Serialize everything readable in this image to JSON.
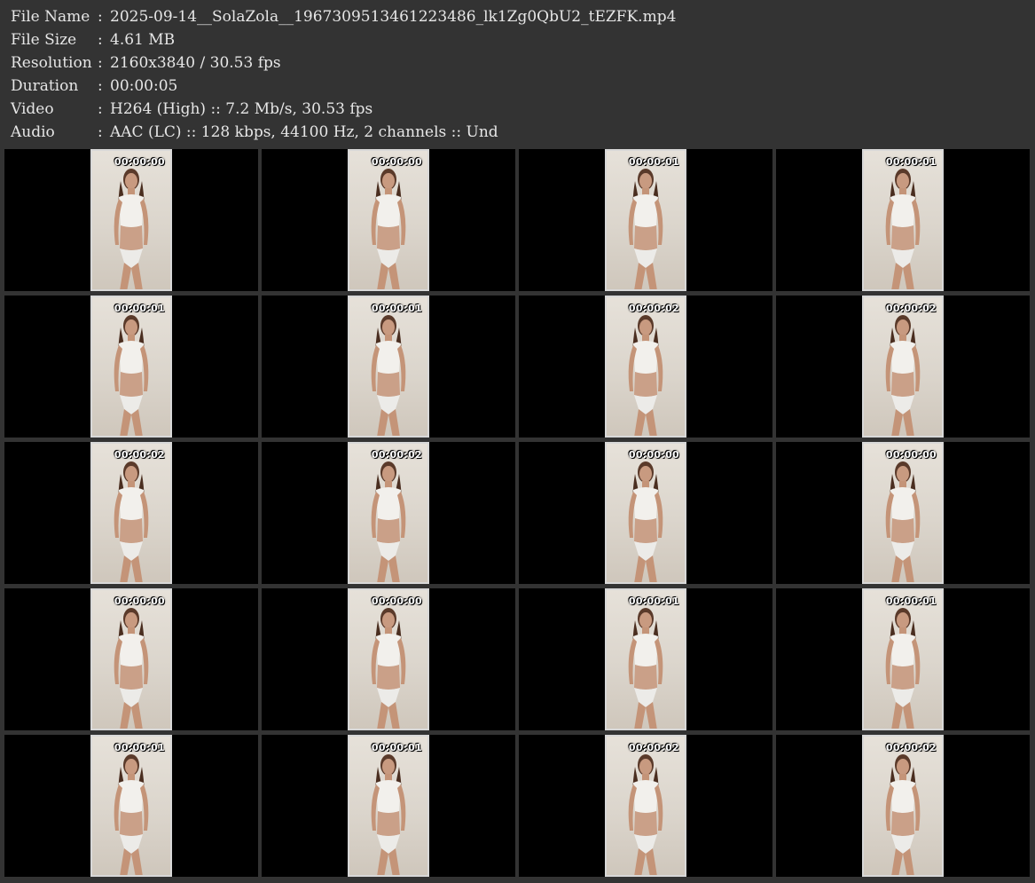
{
  "info": [
    {
      "key": "File Name",
      "value": "2025-09-14__SolaZola__1967309513461223486_lk1Zg0QbU2_tEZFK.mp4"
    },
    {
      "key": "File Size",
      "value": "4.61 MB"
    },
    {
      "key": "Resolution",
      "value": "2160x3840 / 30.53 fps"
    },
    {
      "key": "Duration",
      "value": "00:00:05"
    },
    {
      "key": "Video",
      "value": "H264 (High) :: 7.2 Mb/s, 30.53 fps"
    },
    {
      "key": "Audio",
      "value": "AAC (LC) :: 128 kbps, 44100 Hz, 2 channels :: Und"
    }
  ],
  "separator": ":",
  "thumbnails": [
    {
      "timestamp": "00:00:00"
    },
    {
      "timestamp": "00:00:00"
    },
    {
      "timestamp": "00:00:01"
    },
    {
      "timestamp": "00:00:01"
    },
    {
      "timestamp": "00:00:01"
    },
    {
      "timestamp": "00:00:01"
    },
    {
      "timestamp": "00:00:02"
    },
    {
      "timestamp": "00:00:02"
    },
    {
      "timestamp": "00:00:02"
    },
    {
      "timestamp": "00:00:02"
    },
    {
      "timestamp": "00:00:00"
    },
    {
      "timestamp": "00:00:00"
    },
    {
      "timestamp": "00:00:00"
    },
    {
      "timestamp": "00:00:00"
    },
    {
      "timestamp": "00:00:01"
    },
    {
      "timestamp": "00:00:01"
    },
    {
      "timestamp": "00:00:01"
    },
    {
      "timestamp": "00:00:01"
    },
    {
      "timestamp": "00:00:02"
    },
    {
      "timestamp": "00:00:02"
    }
  ]
}
